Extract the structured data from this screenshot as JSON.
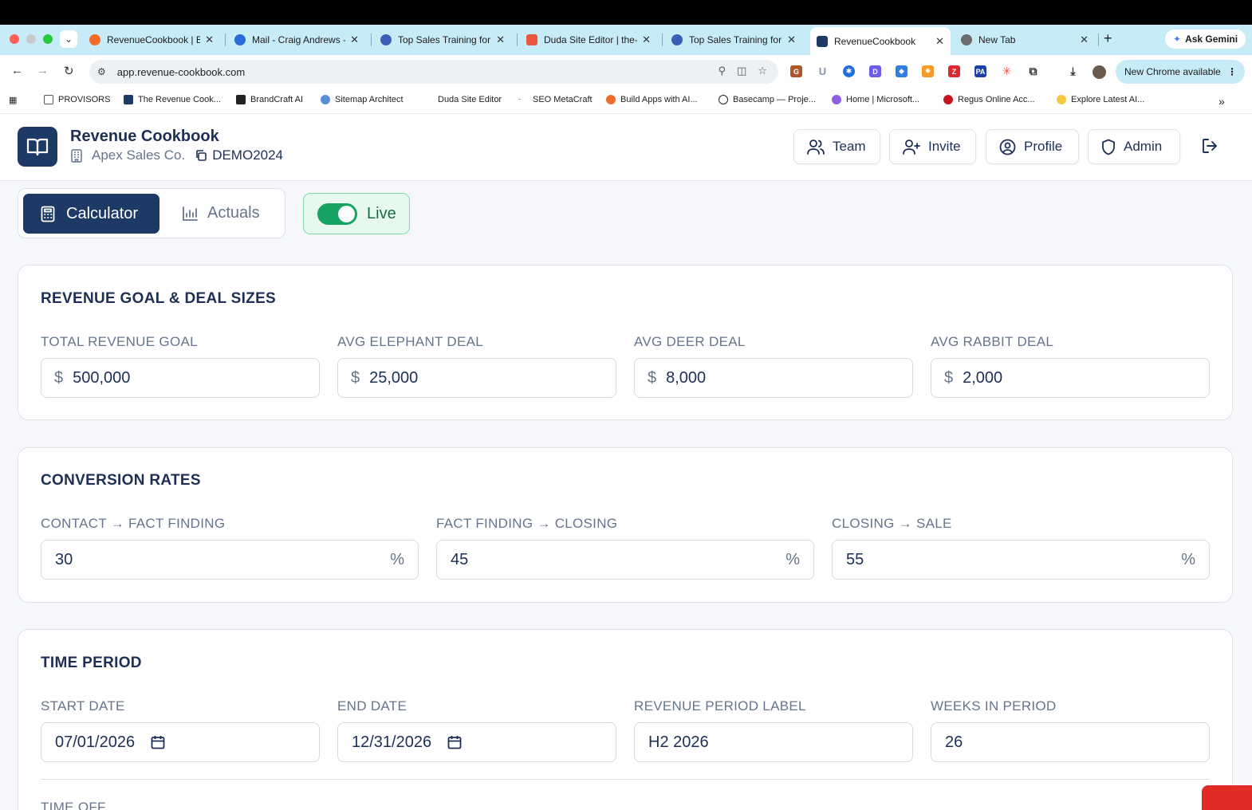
{
  "browser": {
    "tabs": [
      {
        "title": "RevenueCookbook | Ba",
        "color": "#f26b2a"
      },
      {
        "title": "Mail - Craig Andrews -",
        "color": "#2b6bd8"
      },
      {
        "title": "Top Sales Training for",
        "color": "#3a5fb8"
      },
      {
        "title": "Duda Site Editor | the-",
        "color": "#e8573e"
      },
      {
        "title": "Top Sales Training for",
        "color": "#3a5fb8"
      },
      {
        "title": "RevenueCookbook",
        "color": "#1d3a66"
      },
      {
        "title": "New Tab",
        "color": "#6b6b6b"
      }
    ],
    "ask_gemini": "Ask Gemini",
    "url": "app.revenue-cookbook.com",
    "new_chrome": "New Chrome available",
    "bookmarks": [
      "PROVISORS",
      "The Revenue Cook...",
      "BrandCraft AI",
      "Sitemap Architect",
      "Duda Site Editor",
      "SEO MetaCraft",
      "Build Apps with AI...",
      "Basecamp — Proje...",
      "Home | Microsoft...",
      "Regus Online Acc...",
      "Explore Latest AI..."
    ]
  },
  "header": {
    "title": "Revenue Cookbook",
    "company": "Apex Sales Co.",
    "code": "DEMO2024",
    "buttons": {
      "team": "Team",
      "invite": "Invite",
      "profile": "Profile",
      "admin": "Admin"
    }
  },
  "modes": {
    "calculator": "Calculator",
    "actuals": "Actuals",
    "live": "Live"
  },
  "revenue": {
    "title": "REVENUE GOAL & DEAL SIZES",
    "fields": [
      {
        "label": "TOTAL REVENUE GOAL",
        "prefix": "$",
        "value": "500,000"
      },
      {
        "label": "AVG ELEPHANT DEAL",
        "prefix": "$",
        "value": "25,000"
      },
      {
        "label": "AVG DEER DEAL",
        "prefix": "$",
        "value": "8,000"
      },
      {
        "label": "AVG RABBIT DEAL",
        "prefix": "$",
        "value": "2,000"
      }
    ]
  },
  "conversion": {
    "title": "CONVERSION RATES",
    "fields": [
      {
        "label": "CONTACT → FACT FINDING",
        "value": "30",
        "suffix": "%"
      },
      {
        "label": "FACT FINDING → CLOSING",
        "value": "45",
        "suffix": "%"
      },
      {
        "label": "CLOSING → SALE",
        "value": "55",
        "suffix": "%"
      }
    ]
  },
  "period": {
    "title": "TIME PERIOD",
    "fields": [
      {
        "label": "START DATE",
        "value": "07/01/2026"
      },
      {
        "label": "END DATE",
        "value": "12/31/2026"
      },
      {
        "label": "REVENUE PERIOD LABEL",
        "value": "H2 2026"
      },
      {
        "label": "WEEKS IN PERIOD",
        "value": "26"
      }
    ],
    "time_off_label": "TIME OFF"
  },
  "colors": {
    "brand": "#1d3a66",
    "live_green": "#17a362",
    "label_gray": "#66758c"
  }
}
